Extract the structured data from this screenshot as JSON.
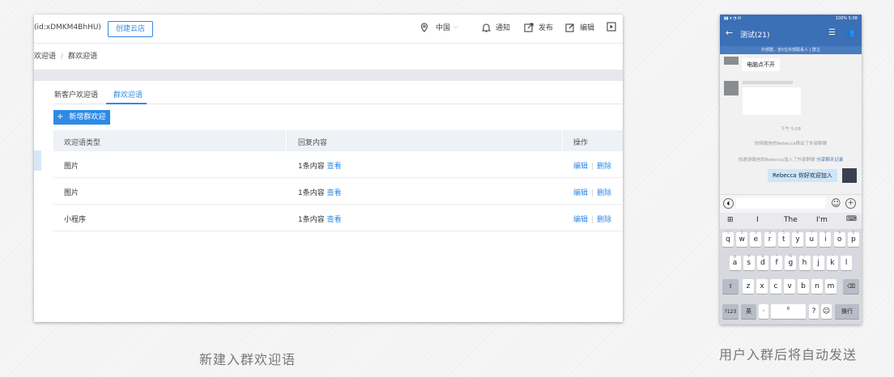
{
  "admin": {
    "corp_id": "(id:xDMKM4BhHU)",
    "create_store_label": "创建云店",
    "nav": {
      "region": "中国",
      "notify": "通知",
      "publish": "发布",
      "edit": "编辑"
    },
    "breadcrumb": [
      "欢迎语",
      "群欢迎语"
    ],
    "tabs": [
      "新客户欢迎语",
      "群欢迎语"
    ],
    "add_button": "新增群欢迎语",
    "table": {
      "headers": [
        "欢迎语类型",
        "回复内容",
        "操作"
      ],
      "rows": [
        {
          "type": "图片",
          "content": "1条内容",
          "view": "查看",
          "edit": "编辑",
          "delete": "删除"
        },
        {
          "type": "图片",
          "content": "1条内容",
          "view": "查看",
          "edit": "编辑",
          "delete": "删除"
        },
        {
          "type": "小程序",
          "content": "1条内容",
          "view": "查看",
          "edit": "编辑",
          "delete": "删除"
        }
      ]
    }
  },
  "captions": {
    "left": "新建入群欢迎语",
    "right": "用户入群后将自动发送"
  },
  "phone": {
    "status_right": "100% 5:08",
    "chat_title": "测试(21)",
    "notice": "外部群，含5位外部联系人 | 群主",
    "message1": "电脑点不开",
    "time": "下午 5:08",
    "sys1": "你将微信的Rebecca移出了外部群聊",
    "sys2_prefix": "你邀请微信的Rebecca加入了外部群聊",
    "sys2_link": "分享聊天记录",
    "welcome_msg": "Rebecca 你好欢迎加入",
    "suggestions": [
      "I",
      "The",
      "I'm"
    ],
    "rows": {
      "r1": [
        "q",
        "w",
        "e",
        "r",
        "t",
        "y",
        "u",
        "i",
        "o",
        "p"
      ],
      "r1_sub": [
        "1",
        "2",
        "3",
        "4",
        "5",
        "6",
        "7",
        "8",
        "9",
        "0"
      ],
      "r2": [
        "a",
        "s",
        "d",
        "f",
        "g",
        "h",
        "j",
        "k",
        "l"
      ],
      "r2_sub": [
        "@",
        "#",
        "&",
        "*",
        "%",
        "(",
        ")",
        "\"",
        ""
      ],
      "r3": [
        "z",
        "x",
        "c",
        "v",
        "b",
        "n",
        "m"
      ],
      "r3_sub": [
        "",
        "",
        "",
        "",
        "",
        "",
        ""
      ]
    },
    "keys": {
      "num": "?123",
      "lang": "英",
      "dot": "·",
      "space_hint": "6",
      "question": "?",
      "enter": "换行"
    },
    "accent": "#3b6fb6"
  },
  "colors": {
    "primary": "#2f8ae5",
    "header_bg": "#eef1f6"
  }
}
